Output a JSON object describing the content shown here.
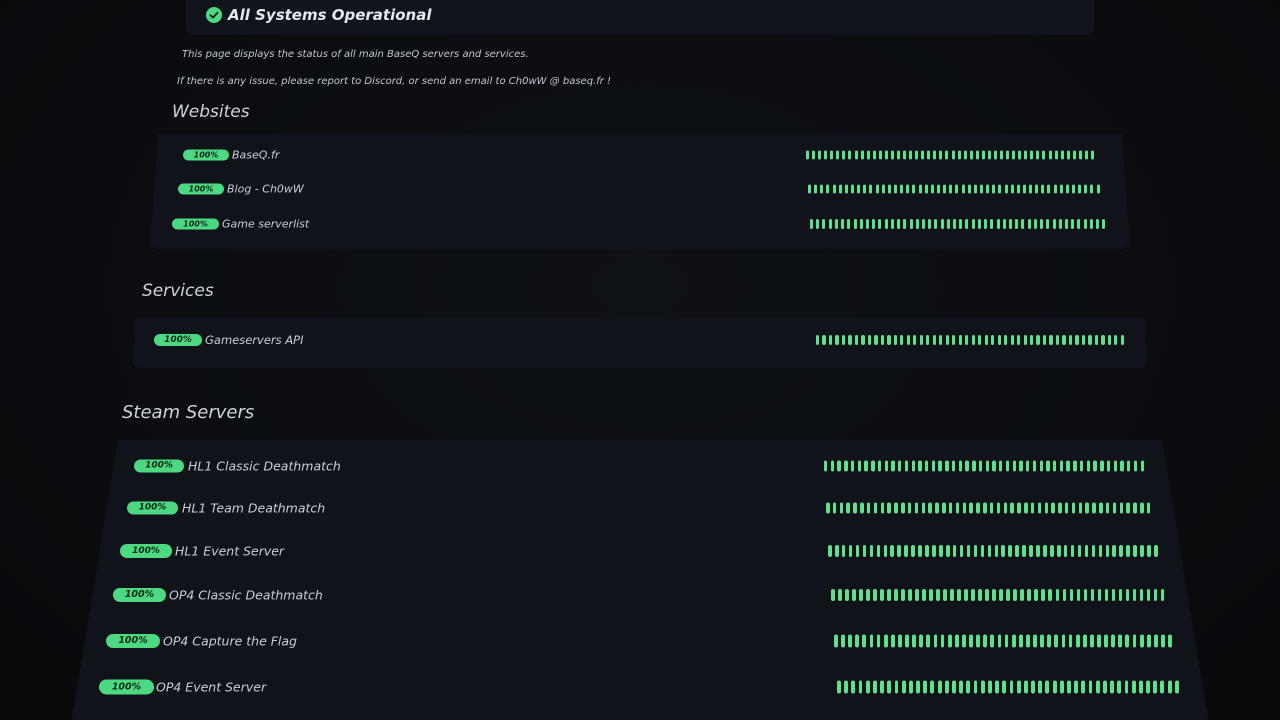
{
  "status_banner": {
    "title": "All Systems Operational",
    "icon": "check-circle-icon",
    "color": "#4cd982"
  },
  "intro": {
    "line1": "This page displays the status of all main BaseQ servers and services.",
    "line2": "If there is any issue, please report to Discord, or send an email to Ch0wW @ baseq.fr !"
  },
  "colors": {
    "ok": "#4cd982",
    "bar": "#5fe08e",
    "panel": "#10131a",
    "background": "#0b0d10"
  },
  "sections": [
    {
      "title": "Websites",
      "items": [
        {
          "uptime": "100%",
          "name": "BaseQ.fr",
          "bars": 48
        },
        {
          "uptime": "100%",
          "name": "Blog - Ch0wW",
          "bars": 48
        },
        {
          "uptime": "100%",
          "name": "Game serverlist",
          "bars": 48
        }
      ]
    },
    {
      "title": "Services",
      "items": [
        {
          "uptime": "100%",
          "name": "Gameservers API",
          "bars": 48
        }
      ]
    },
    {
      "title": "Steam Servers",
      "items": [
        {
          "uptime": "100%",
          "name": "HL1 Classic Deathmatch",
          "bars": 48
        },
        {
          "uptime": "100%",
          "name": "HL1 Team Deathmatch",
          "bars": 48
        },
        {
          "uptime": "100%",
          "name": "HL1 Event Server",
          "bars": 48
        },
        {
          "uptime": "100%",
          "name": "OP4 Classic Deathmatch",
          "bars": 48
        },
        {
          "uptime": "100%",
          "name": "OP4 Capture the Flag",
          "bars": 48
        },
        {
          "uptime": "100%",
          "name": "OP4 Event Server",
          "bars": 48
        }
      ]
    }
  ]
}
